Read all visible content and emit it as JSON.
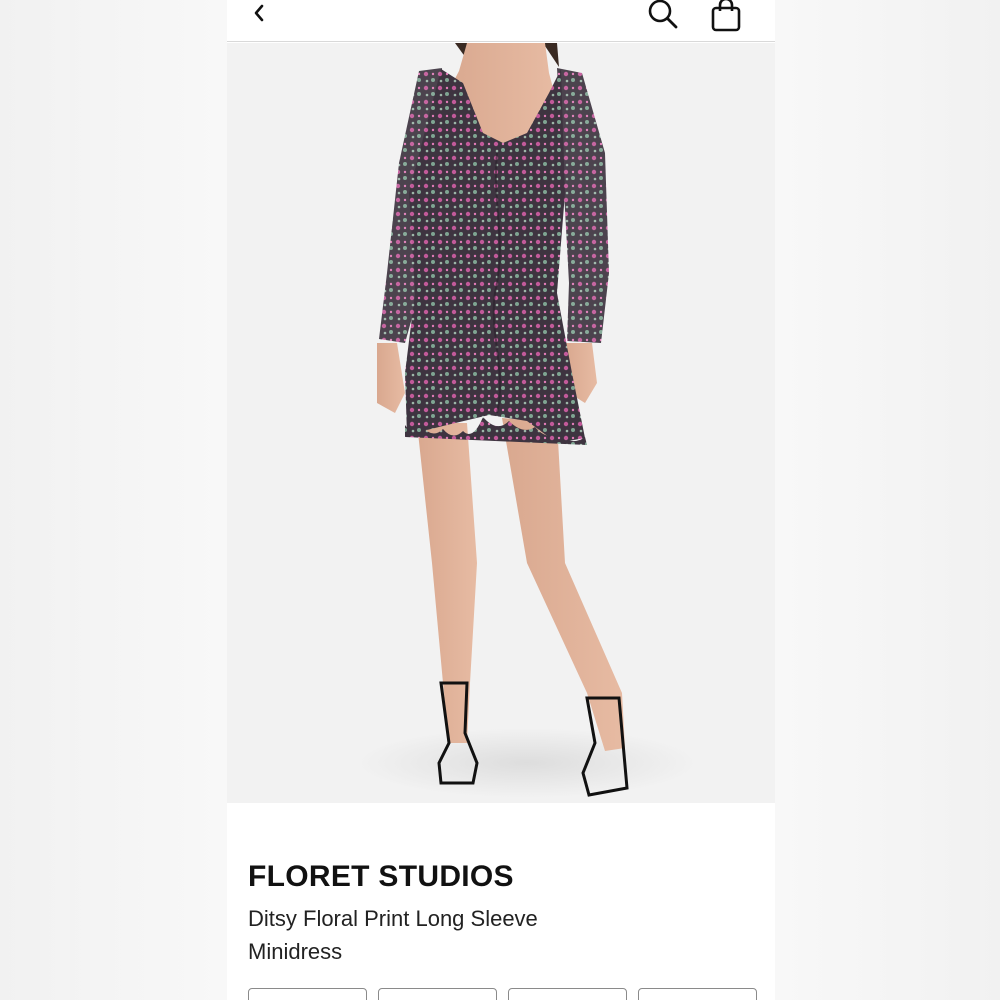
{
  "header": {
    "back_icon": "chevron-left-icon",
    "search_icon": "search-icon",
    "bag_icon": "shopping-bag-icon"
  },
  "product": {
    "brand": "FLORET STUDIOS",
    "name": "Ditsy Floral Print Long Sleeve Minidress",
    "image_description_icon": "product-photo"
  },
  "colors": {
    "page_bg": "#f4f4f4",
    "card_bg": "#ffffff",
    "text_primary": "#111111",
    "divider": "#d9d9d9"
  },
  "size_options": [
    "",
    "",
    "",
    ""
  ]
}
